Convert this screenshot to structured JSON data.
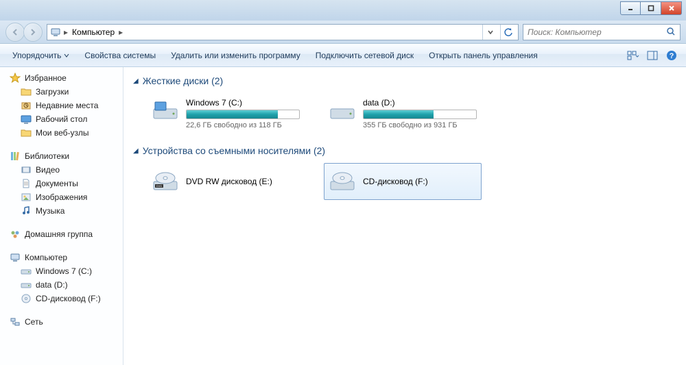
{
  "breadcrumb": {
    "root_label": "Компьютер"
  },
  "search": {
    "placeholder": "Поиск: Компьютер"
  },
  "toolbar": {
    "organize": "Упорядочить",
    "properties": "Свойства системы",
    "uninstall": "Удалить или изменить программу",
    "map_drive": "Подключить сетевой диск",
    "control_panel": "Открыть панель управления"
  },
  "sidebar": {
    "favorites": {
      "header": "Избранное",
      "items": [
        {
          "label": "Загрузки"
        },
        {
          "label": "Недавние места"
        },
        {
          "label": "Рабочий стол"
        },
        {
          "label": "Мои веб-узлы"
        }
      ]
    },
    "libraries": {
      "header": "Библиотеки",
      "items": [
        {
          "label": "Видео"
        },
        {
          "label": "Документы"
        },
        {
          "label": "Изображения"
        },
        {
          "label": "Музыка"
        }
      ]
    },
    "homegroup": {
      "header": "Домашняя группа"
    },
    "computer": {
      "header": "Компьютер",
      "items": [
        {
          "label": "Windows 7 (C:)"
        },
        {
          "label": "data (D:)"
        },
        {
          "label": "CD-дисковод (F:)"
        }
      ]
    },
    "network": {
      "header": "Сеть"
    }
  },
  "sections": {
    "hdd": {
      "title": "Жесткие диски (2)",
      "drives": [
        {
          "name": "Windows 7 (C:)",
          "free": "22,6 ГБ свободно из 118 ГБ",
          "fill_pct": 81
        },
        {
          "name": "data (D:)",
          "free": "355 ГБ свободно из 931 ГБ",
          "fill_pct": 62
        }
      ]
    },
    "removable": {
      "title": "Устройства со съемными носителями (2)",
      "drives": [
        {
          "name": "DVD RW дисковод (E:)"
        },
        {
          "name": "CD-дисковод (F:)"
        }
      ]
    }
  }
}
